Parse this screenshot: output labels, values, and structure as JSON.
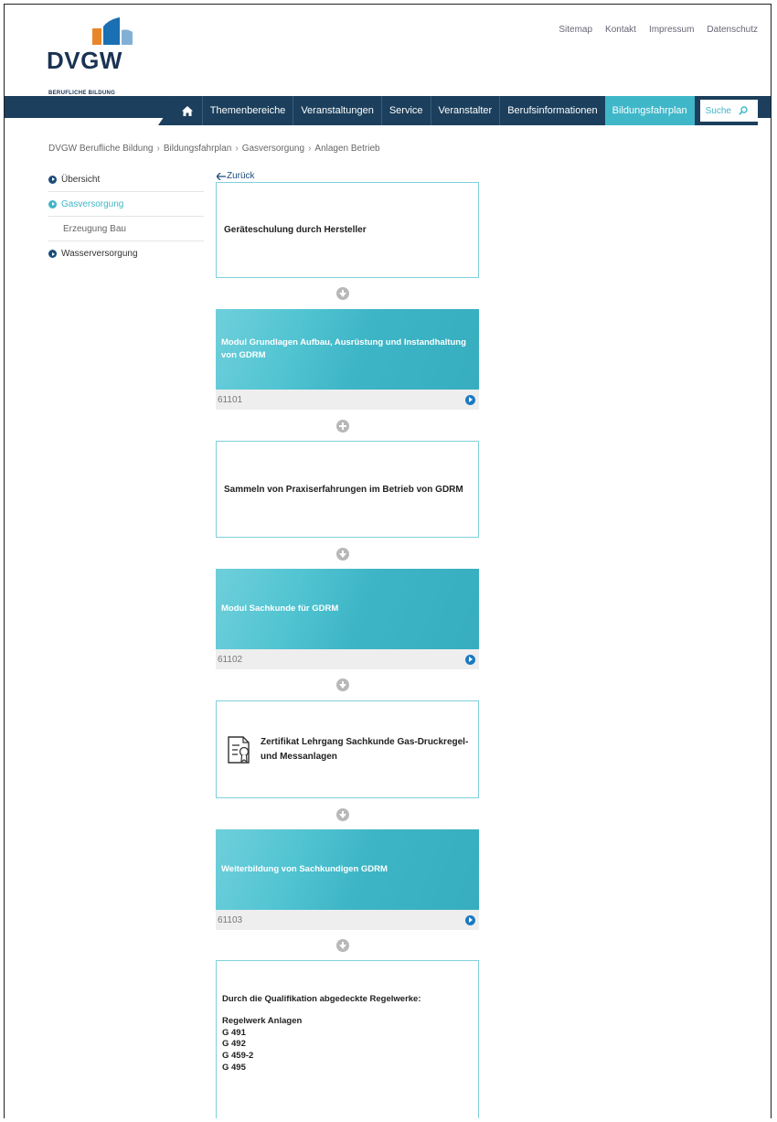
{
  "brand": {
    "name": "DVGW",
    "subtitle": "BERUFLICHE BILDUNG"
  },
  "topnav": [
    "Sitemap",
    "Kontakt",
    "Impressum",
    "Datenschutz"
  ],
  "nav": {
    "items": [
      "Themenbereiche",
      "Veranstaltungen",
      "Service",
      "Veranstalter",
      "Berufsinformationen",
      "Bildungsfahrplan"
    ],
    "active": "Bildungsfahrplan",
    "search_label": "Suche"
  },
  "breadcrumb": [
    "DVGW Berufliche Bildung",
    "Bildungsfahrplan",
    "Gasversorgung",
    "Anlagen Betrieb"
  ],
  "sidebar": {
    "items": [
      {
        "label": "Übersicht"
      },
      {
        "label": "Gasversorgung"
      },
      {
        "label": "Erzeugung Bau"
      },
      {
        "label": "Wasserversorgung"
      }
    ]
  },
  "back_label": "Zurück",
  "steps": [
    {
      "text": "Geräteschulung durch Hersteller"
    },
    {
      "text": "Modul Grundlagen Aufbau, Ausrüstung und Instandhaltung von GDRM",
      "code": "61101"
    },
    {
      "text": "Sammeln von Praxiserfahrungen im Betrieb von GDRM"
    },
    {
      "text": "Modul Sachkunde für GDRM",
      "code": "61102"
    },
    {
      "text": "Zertifikat Lehrgang Sachkunde Gas-Druckregel- und Messanlagen"
    },
    {
      "text": "Weiterbildung von Sachkundigen GDRM",
      "code": "61103"
    }
  ],
  "regelwerke": {
    "heading": "Durch die Qualifikation abgedeckte Regelwerke:",
    "group": "Regelwerk Anlagen",
    "items": [
      "G 491",
      "G 492",
      "G 459-2",
      "G 495"
    ]
  },
  "colors": {
    "navy": "#1b3f5c",
    "teal": "#3fb7c8",
    "logo_orange": "#e8862a",
    "logo_blue": "#1b6fb3"
  }
}
